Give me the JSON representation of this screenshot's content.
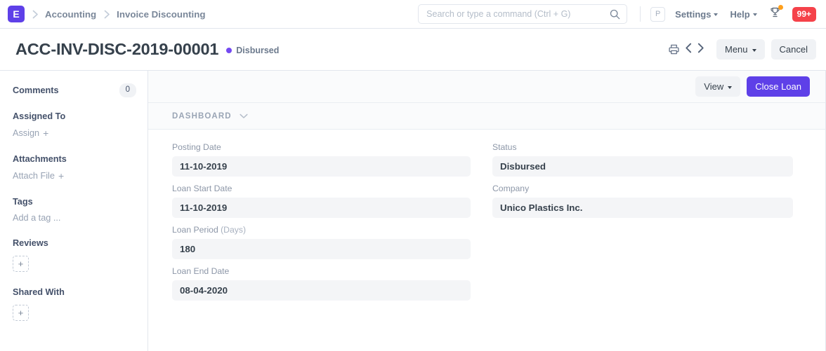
{
  "navbar": {
    "logo_letter": "E",
    "breadcrumbs": [
      {
        "label": "Accounting"
      },
      {
        "label": "Invoice Discounting"
      }
    ],
    "search": {
      "placeholder": "Search or type a command (Ctrl + G)",
      "value": ""
    },
    "avatar_letter": "P",
    "settings_label": "Settings",
    "help_label": "Help",
    "notification_badge": "99+",
    "colors": {
      "brand_purple": "#5e40e8",
      "badge_red": "#f5424a",
      "trophy_dot_orange": "#ff9f1a"
    }
  },
  "page_head": {
    "title": "ACC-INV-DISC-2019-00001",
    "status": "Disbursed",
    "status_color": "#7449f1",
    "menu_label": "Menu",
    "cancel_label": "Cancel"
  },
  "sidebar": {
    "comments_label": "Comments",
    "comments_count": "0",
    "assigned_to_label": "Assigned To",
    "assign_label": "Assign",
    "attachments_label": "Attachments",
    "attach_file_label": "Attach File",
    "tags_label": "Tags",
    "add_tag_label": "Add a tag ...",
    "reviews_label": "Reviews",
    "shared_with_label": "Shared With",
    "plus_glyph": "+"
  },
  "main": {
    "view_label": "View",
    "close_loan_label": "Close Loan",
    "section_label": "DASHBOARD",
    "fields_left": [
      {
        "label": "Posting Date",
        "sub": "",
        "value": "11-10-2019"
      },
      {
        "label": "Loan Start Date",
        "sub": "",
        "value": "11-10-2019"
      },
      {
        "label": "Loan Period ",
        "sub": "(Days)",
        "value": "180"
      },
      {
        "label": "Loan End Date",
        "sub": "",
        "value": "08-04-2020"
      }
    ],
    "fields_right": [
      {
        "label": "Status",
        "sub": "",
        "value": "Disbursed"
      },
      {
        "label": "Company",
        "sub": "",
        "value": "Unico Plastics Inc."
      }
    ]
  }
}
